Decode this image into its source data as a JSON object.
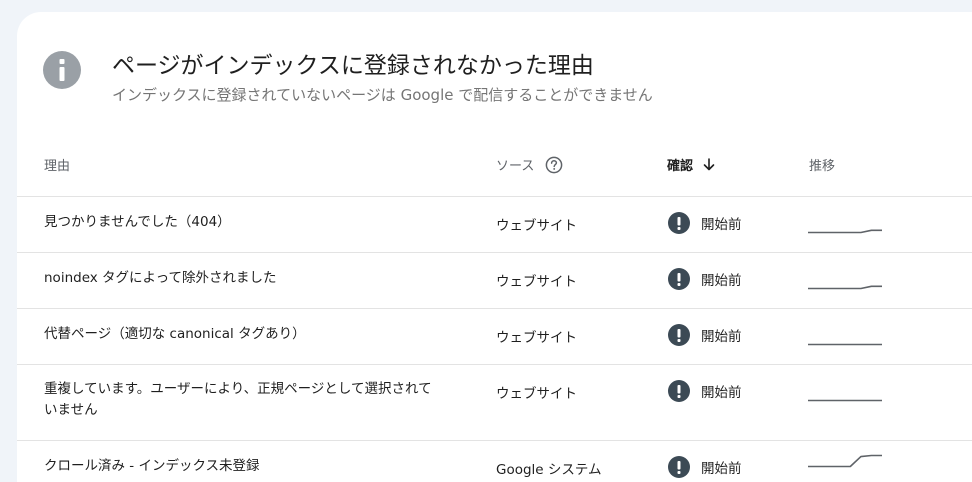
{
  "header": {
    "title": "ページがインデックスに登録されなかった理由",
    "subtitle": "インデックスに登録されていないページは Google で配信することができません",
    "icon": "info-icon"
  },
  "columns": {
    "reason": "理由",
    "source": "ソース",
    "validation": "確認",
    "trend": "推移"
  },
  "colors": {
    "status_icon": "#3c4a55",
    "header_icon": "#9aa0a6",
    "sparkline": "#5f6368"
  },
  "rows": [
    {
      "reason": "見つかりませんでした（404）",
      "source": "ウェブサイト",
      "status": "開始前",
      "trend": [
        0,
        0,
        0,
        0,
        0,
        0,
        0.2,
        0.2
      ]
    },
    {
      "reason": "noindex タグによって除外されました",
      "source": "ウェブサイト",
      "status": "開始前",
      "trend": [
        0,
        0,
        0,
        0,
        0,
        0,
        0.2,
        0.2
      ]
    },
    {
      "reason": "代替ページ（適切な canonical タグあり）",
      "source": "ウェブサイト",
      "status": "開始前",
      "trend": [
        0,
        0,
        0,
        0,
        0,
        0,
        0,
        0
      ]
    },
    {
      "reason": "重複しています。ユーザーにより、正規ページとして選択されていません",
      "source": "ウェブサイト",
      "status": "開始前",
      "trend": [
        0,
        0,
        0,
        0,
        0,
        0,
        0,
        0
      ]
    },
    {
      "reason": "クロール済み - インデックス未登録",
      "source": "Google システム",
      "status": "開始前",
      "trend": [
        0,
        0,
        0,
        0,
        0,
        0.9,
        1,
        1
      ]
    }
  ]
}
